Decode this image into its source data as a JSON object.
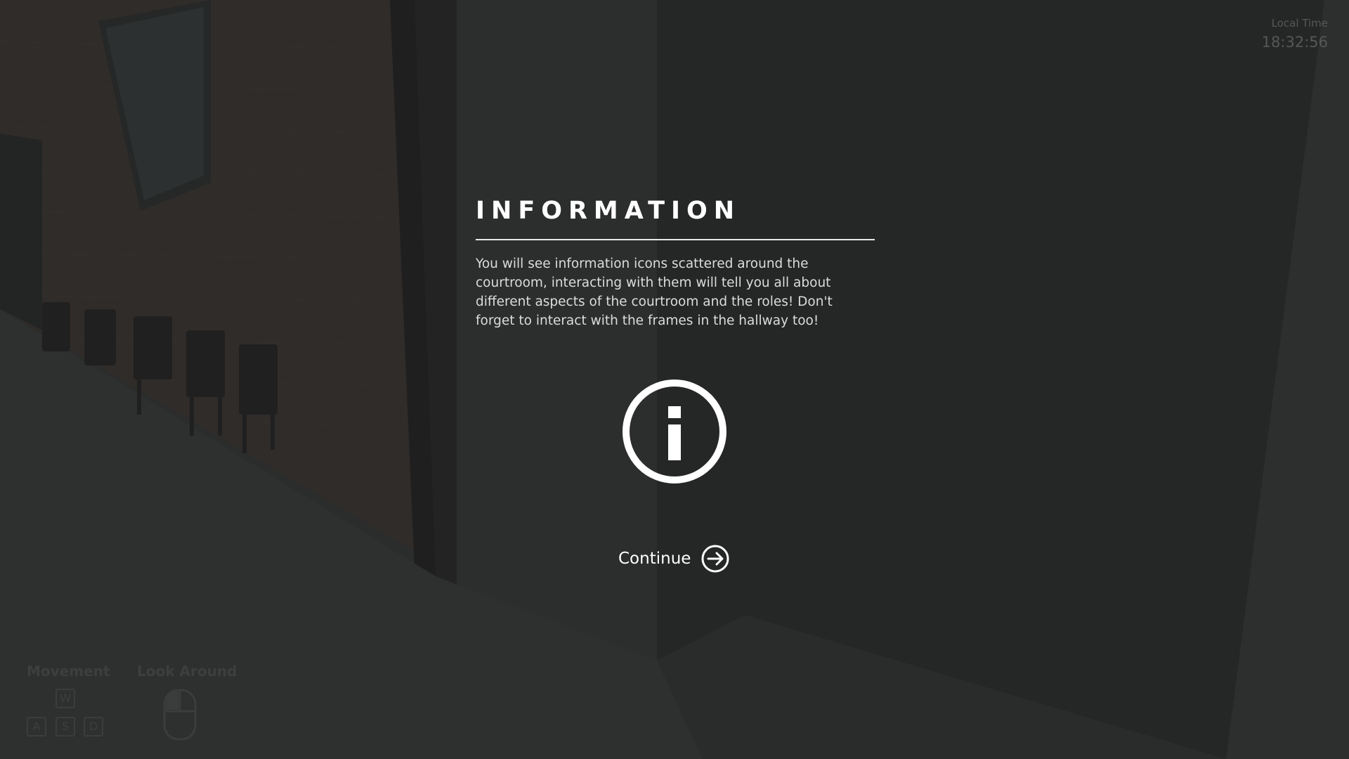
{
  "clock": {
    "label": "Local Time",
    "value": "18:32:56"
  },
  "controls": {
    "movement_label": "Movement",
    "look_label": "Look Around",
    "keys": {
      "w": "W",
      "a": "A",
      "s": "S",
      "d": "D"
    },
    "look_icon": "mouse-icon"
  },
  "modal": {
    "title": "INFORMATION",
    "body": "You will see information icons scattered around the courtroom, interacting with them will tell you all about different aspects of the courtroom and the roles! Don't forget to interact with the frames in the hallway too!",
    "icon": "info-icon",
    "continue_label": "Continue",
    "continue_icon": "arrow-right-circle-icon"
  },
  "colors": {
    "overlay_text": "#ffffff",
    "background": "#2a2b2b"
  }
}
